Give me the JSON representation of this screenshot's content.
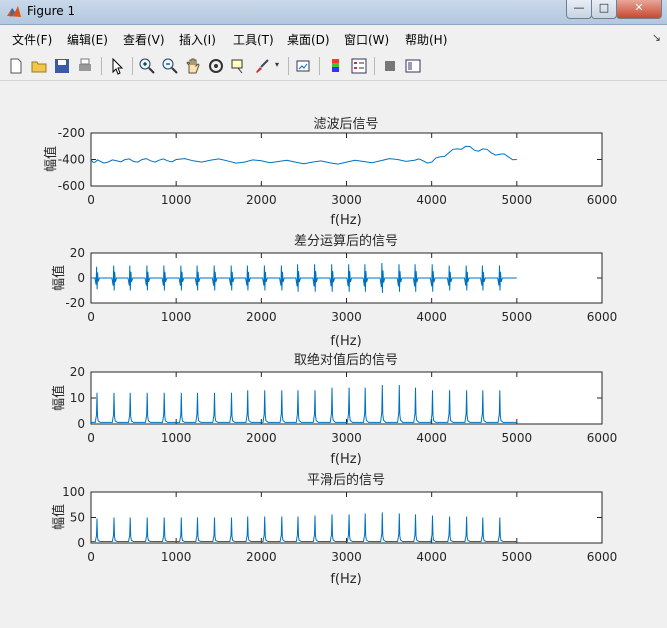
{
  "window": {
    "title": "Figure 1",
    "minimize": "—",
    "maximize": "□",
    "close": "✕"
  },
  "menu": [
    "文件(F)",
    "编辑(E)",
    "查看(V)",
    "插入(I)",
    "工具(T)",
    "桌面(D)",
    "窗口(W)",
    "帮助(H)"
  ],
  "toolbar": [
    "new-figure-icon",
    "open-icon",
    "save-icon",
    "print-icon",
    "pointer-icon",
    "zoom-in-icon",
    "zoom-out-icon",
    "pan-icon",
    "rotate-icon",
    "data-cursor-icon",
    "brush-icon",
    "link-icon",
    "colorbar-icon",
    "legend-icon",
    "hide-tools-icon",
    "show-tools-icon"
  ],
  "colors": {
    "line": "#0072bd",
    "axes": "#262626"
  },
  "chart_data": [
    {
      "type": "line",
      "title": "滤波后信号",
      "xlabel": "f(Hz)",
      "ylabel": "幅值",
      "xlim": [
        0,
        6000
      ],
      "ylim": [
        -600,
        -200
      ],
      "xticks": [
        "0",
        "1000",
        "2000",
        "3000",
        "4000",
        "5000",
        "6000"
      ],
      "yticks": [
        "-200",
        "-400",
        "-600"
      ],
      "ytick_values": [
        -200,
        -400,
        -600
      ],
      "grid": false,
      "series": [
        {
          "x": [
            0,
            50,
            100,
            200,
            300,
            400,
            500,
            600,
            700,
            800,
            900,
            1000,
            1200,
            1400,
            1600,
            1800,
            2000,
            2200,
            2400,
            2600,
            2800,
            3000,
            3200,
            3400,
            3600,
            3800,
            3900,
            4000,
            4100,
            4200,
            4300,
            4400,
            4500,
            4600,
            4700,
            4800,
            4900,
            5000
          ],
          "values": [
            -400,
            -420,
            -410,
            -420,
            -410,
            -400,
            -415,
            -400,
            -410,
            -405,
            -410,
            -400,
            -410,
            -405,
            -410,
            -420,
            -410,
            -415,
            -420,
            -420,
            -425,
            -420,
            -415,
            -410,
            -400,
            -405,
            -410,
            -420,
            -380,
            -350,
            -320,
            -300,
            -330,
            -320,
            -350,
            -360,
            -380,
            -400
          ]
        }
      ]
    },
    {
      "type": "line",
      "title": "差分运算后的信号",
      "xlabel": "f(Hz)",
      "ylabel": "幅值",
      "xlim": [
        0,
        6000
      ],
      "ylim": [
        -20,
        20
      ],
      "xticks": [
        "0",
        "1000",
        "2000",
        "3000",
        "4000",
        "5000",
        "6000"
      ],
      "yticks": [
        "20",
        "0",
        "-20"
      ],
      "ytick_values": [
        20,
        0,
        -20
      ],
      "grid": false,
      "peaks": [
        70,
        270,
        460,
        660,
        860,
        1060,
        1250,
        1450,
        1650,
        1840,
        2040,
        2240,
        2430,
        2630,
        2830,
        3030,
        3220,
        3420,
        3620,
        3810,
        4010,
        4210,
        4410,
        4600,
        4800
      ],
      "peak_max": [
        9,
        10,
        10,
        10,
        10,
        10,
        10,
        10,
        10,
        10,
        10,
        10,
        11,
        11,
        11,
        11,
        11,
        12,
        11,
        11,
        11,
        10,
        10,
        10,
        10
      ],
      "peak_min": [
        -9,
        -10,
        -10,
        -10,
        -10,
        -10,
        -10,
        -10,
        -10,
        -10,
        -10,
        -10,
        -11,
        -11,
        -11,
        -11,
        -11,
        -12,
        -11,
        -11,
        -11,
        -10,
        -10,
        -10,
        -10
      ],
      "x_end": 5000
    },
    {
      "type": "line",
      "title": "取绝对值后的信号",
      "xlabel": "f(Hz)",
      "ylabel": "幅值",
      "xlim": [
        0,
        6000
      ],
      "ylim": [
        0,
        20
      ],
      "xticks": [
        "0",
        "1000",
        "2000",
        "3000",
        "4000",
        "5000",
        "6000"
      ],
      "yticks": [
        "20",
        "10",
        "0"
      ],
      "ytick_values": [
        20,
        10,
        0
      ],
      "grid": false,
      "peaks": [
        70,
        270,
        460,
        660,
        860,
        1060,
        1250,
        1450,
        1650,
        1840,
        2040,
        2240,
        2430,
        2630,
        2830,
        3030,
        3220,
        3420,
        3620,
        3810,
        4010,
        4210,
        4410,
        4600,
        4800
      ],
      "peak_values": [
        12,
        12,
        12,
        12,
        12,
        12,
        12,
        12,
        12,
        13,
        13,
        13,
        13,
        13,
        14,
        14,
        14,
        15,
        15,
        14,
        13,
        13,
        13,
        13,
        13
      ],
      "x_end": 5000
    },
    {
      "type": "line",
      "title": "平滑后的信号",
      "xlabel": "f(Hz)",
      "ylabel": "幅值",
      "xlim": [
        0,
        6000
      ],
      "ylim": [
        0,
        100
      ],
      "xticks": [
        "0",
        "1000",
        "2000",
        "3000",
        "4000",
        "5000",
        "6000"
      ],
      "yticks": [
        "100",
        "50",
        "0"
      ],
      "ytick_values": [
        100,
        50,
        0
      ],
      "grid": false,
      "peaks": [
        70,
        270,
        460,
        660,
        860,
        1060,
        1250,
        1450,
        1650,
        1840,
        2040,
        2240,
        2430,
        2630,
        2830,
        3030,
        3220,
        3420,
        3620,
        3810,
        4010,
        4210,
        4410,
        4600,
        4800
      ],
      "peak_values": [
        48,
        50,
        50,
        50,
        50,
        50,
        50,
        50,
        50,
        52,
        52,
        52,
        52,
        54,
        56,
        56,
        58,
        60,
        58,
        56,
        54,
        52,
        52,
        50,
        50
      ],
      "x_end": 5000
    }
  ]
}
